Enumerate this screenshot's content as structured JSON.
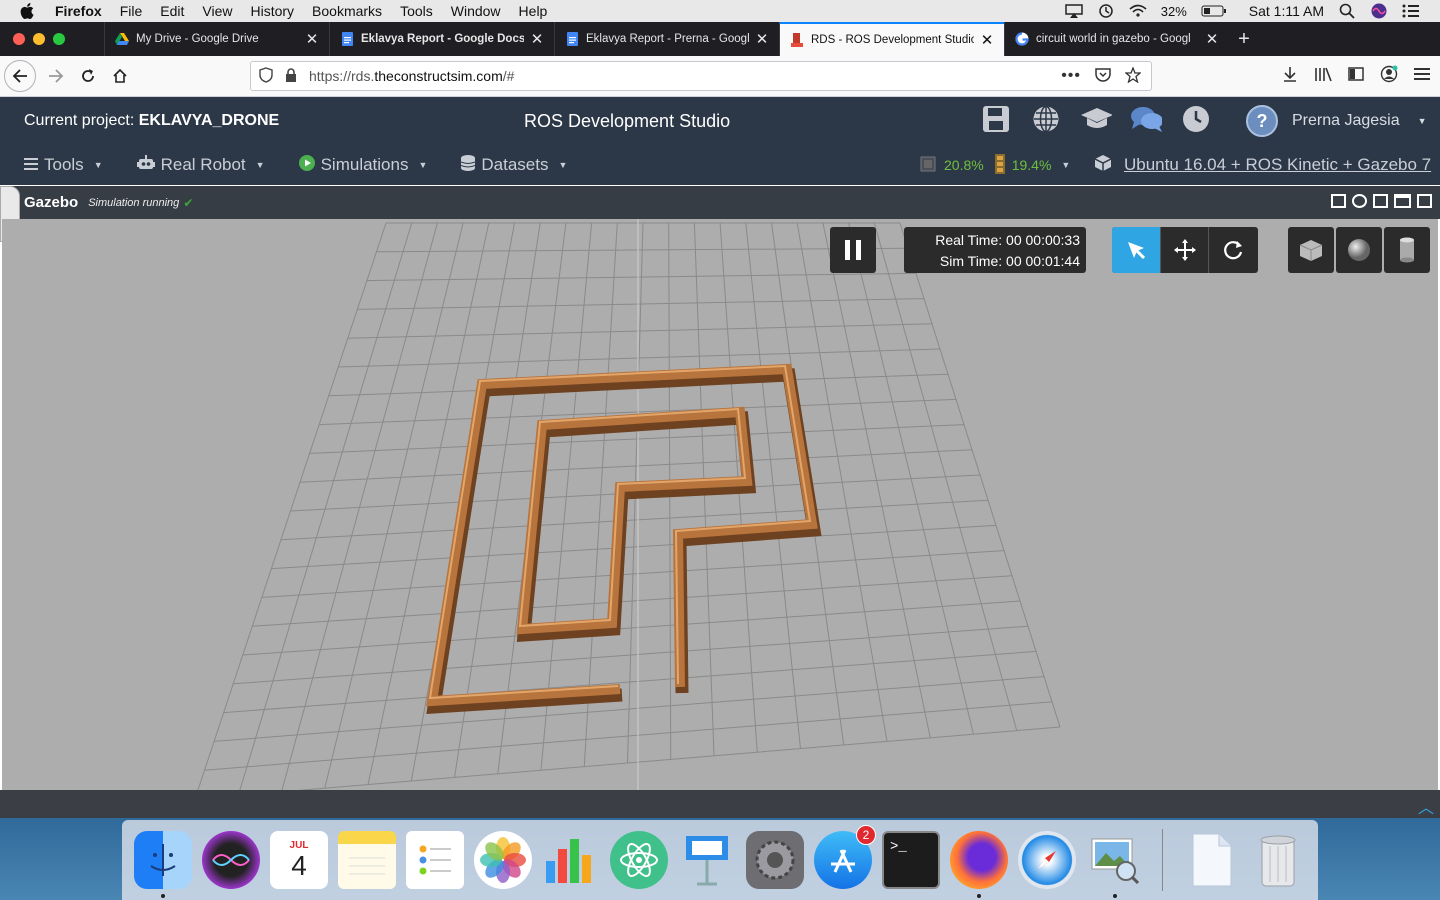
{
  "menubar": {
    "app": "Firefox",
    "items": [
      "File",
      "Edit",
      "View",
      "History",
      "Bookmarks",
      "Tools",
      "Window",
      "Help"
    ],
    "battery": "32%",
    "clock": "Sat 1:11 AM"
  },
  "tabs": [
    {
      "title": "My Drive - Google Drive",
      "icon": "google-drive-icon"
    },
    {
      "title": "Eklavya Report - Google Docs",
      "icon": "google-docs-icon"
    },
    {
      "title": "Eklavya Report - Prerna - Googl",
      "icon": "google-docs-icon"
    },
    {
      "title": "RDS - ROS Development Studio",
      "icon": "rds-icon"
    },
    {
      "title": "circuit world in gazebo - Googl",
      "icon": "google-icon"
    }
  ],
  "active_tab_index": 3,
  "url": {
    "prefix": "https://rds.",
    "host": "theconstructsim.com",
    "suffix": "/#"
  },
  "app": {
    "project_label": "Current project: ",
    "project_name": "EKLAVYA_DRONE",
    "title": "ROS Development Studio",
    "user": "Prerna Jagesia",
    "menus": [
      "Tools",
      "Real Robot",
      "Simulations",
      "Datasets"
    ],
    "cpu": "20.8%",
    "mem": "19.4%",
    "environment": "Ubuntu 16.04 + ROS Kinetic + Gazebo 7"
  },
  "gazebo": {
    "title": "Gazebo",
    "status": "Simulation running",
    "real_time": "Real Time: 00 00:00:33",
    "sim_time": "Sim Time: 00 00:01:44"
  },
  "dock": {
    "apps": [
      "Finder",
      "Siri",
      "Calendar",
      "Notes",
      "Reminders",
      "Photos",
      "Numbers",
      "Atom",
      "Keynote",
      "System Preferences",
      "App Store",
      "Terminal",
      "Firefox",
      "Safari",
      "Preview",
      "Documents",
      "Trash"
    ],
    "calendar_month": "JUL",
    "calendar_day": "4",
    "appstore_badge": "2"
  },
  "colors": {
    "accent": "#2fa5e3",
    "header": "#2c3847",
    "wood": "#b8743d"
  }
}
